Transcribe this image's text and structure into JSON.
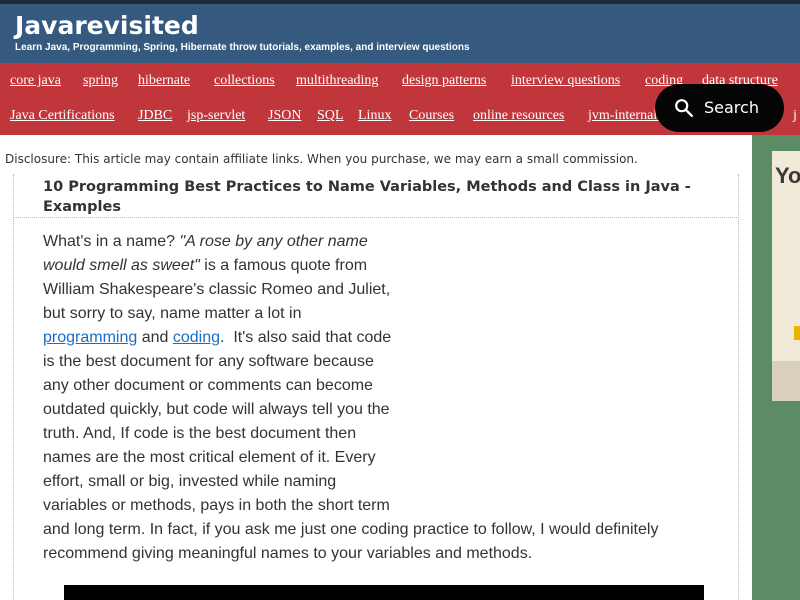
{
  "header": {
    "title": "Javarevisited",
    "tagline": "Learn Java, Programming, Spring, Hibernate throw tutorials, examples, and interview questions"
  },
  "nav": {
    "row1": [
      "core java",
      "spring",
      "hibernate",
      "collections",
      "multithreading",
      "design patterns",
      "interview questions",
      "coding",
      "data structure"
    ],
    "row2": [
      "Java Certifications",
      "JDBC",
      "jsp-servlet",
      "JSON",
      "SQL",
      "Linux",
      "Courses",
      "online resources",
      "jvm-internals",
      "j"
    ]
  },
  "search": {
    "label": "Search",
    "icon": "search-icon"
  },
  "disclosure": "Disclosure: This article may contain affiliate links. When you purchase, we may earn a small commission.",
  "post": {
    "title": "10 Programming Best Practices to Name Variables, Methods and Class in Java - Examples",
    "body": {
      "l1_plain": "What's in a name? ",
      "l1_quote": "\"A rose by any other name",
      "l2_quote": "would smell as sweet\"",
      "l2_plain": " is a famous quote from",
      "l3": "William Shakespeare's classic Romeo and Juliet,",
      "l4": "but sorry to say, name matter a lot in",
      "l5_link1": "programming",
      "l5_mid": " and ",
      "l5_link2": "coding",
      "l5_end": ".  It's also said that code",
      "l6": "is the best document for any software because",
      "l7": "any other document or comments can become",
      "l8": "outdated quickly, but code will always tell you the",
      "l9": "truth. And, If code is the best document then",
      "l10": "names are the most critical element of it. Every",
      "l11": "effort, small or big, invested while naming",
      "l12": "variables or methods, pays in both the short term",
      "l13": "and long term. In fact, if you ask me just one coding practice to follow, I would definitely",
      "l14": "recommend giving meaningful names to your variables and methods."
    }
  },
  "sidebar": {
    "ad_text": "Yo"
  },
  "colors": {
    "header_bg": "#35597f",
    "nav_bg": "#c1363b",
    "sidebar_bg": "#5b8c66",
    "link": "#1a6fc4"
  }
}
